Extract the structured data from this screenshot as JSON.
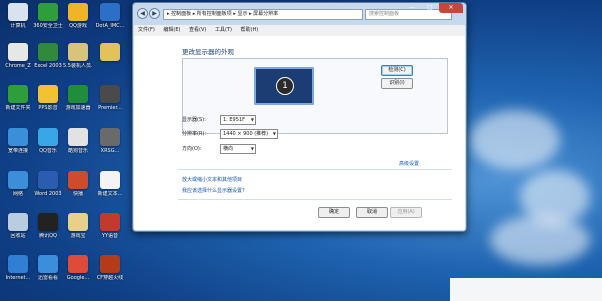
{
  "desktop": {
    "icons": [
      {
        "label": "计算机",
        "color": "#d9e3ef"
      },
      {
        "label": "360安全卫士",
        "color": "#2e9e3a"
      },
      {
        "label": "QQ游戏",
        "color": "#f0b428"
      },
      {
        "label": "DotA_IMC...",
        "color": "#2b6fc6"
      },
      {
        "label": "Chrome_Z",
        "color": "#e7e7e7"
      },
      {
        "label": "Excel 2003",
        "color": "#2f8a3e"
      },
      {
        "label": "5.5装机人员...",
        "color": "#d9c27a"
      },
      {
        "label": "",
        "color": "#e2c25a"
      },
      {
        "label": "新建文件夹",
        "color": "#2e9e3a"
      },
      {
        "label": "PPS影音",
        "color": "#f2c230"
      },
      {
        "label": "游戏加速器",
        "color": "#1f8d3c"
      },
      {
        "label": "Premier...",
        "color": "#4a4a4a"
      },
      {
        "label": "宽带连接",
        "color": "#3a8fd8"
      },
      {
        "label": "QQ音乐",
        "color": "#39a7e5"
      },
      {
        "label": "酷狗音乐",
        "color": "#e2e2e2"
      },
      {
        "label": "XRSG...",
        "color": "#6a6a6a"
      },
      {
        "label": "网络",
        "color": "#3a8fd8"
      },
      {
        "label": "Word 2003",
        "color": "#2a5db0"
      },
      {
        "label": "快播",
        "color": "#d04a2e"
      },
      {
        "label": "新建文本...",
        "color": "#f4f4f4"
      },
      {
        "label": "回收站",
        "color": "#b8cde0"
      },
      {
        "label": "腾讯QQ",
        "color": "#222"
      },
      {
        "label": "游戏宝",
        "color": "#e6d08a"
      },
      {
        "label": "YY语音",
        "color": "#c3392b"
      },
      {
        "label": "Internet...",
        "color": "#2f7fd4"
      },
      {
        "label": "迅雷看看",
        "color": "#3b8edb"
      },
      {
        "label": "Google...",
        "color": "#e04a3a"
      },
      {
        "label": "CF穿越火线",
        "color": "#b23b1a"
      }
    ]
  },
  "window": {
    "nav_back": "◀",
    "nav_forward": "▶",
    "address": "▸ 控制面板 ▸ 所有控制面板项 ▸ 显示 ▸ 屏幕分辨率",
    "search_placeholder": "搜索控制面板",
    "controls": {
      "minimize": "—",
      "maximize": "□",
      "close": "✕"
    },
    "menu": [
      "文件(F)",
      "编辑(E)",
      "查看(V)",
      "工具(T)",
      "帮助(H)"
    ],
    "heading": "更改显示器的外观",
    "monitor_number": "1",
    "detect_button": "检测(C)",
    "identify_button": "识别(I)",
    "display_label": "显示器(S):",
    "display_value": "1. E951F",
    "resolution_label": "分辨率(R):",
    "resolution_value": "1440 × 900 (推荐)",
    "orientation_label": "方向(O):",
    "orientation_value": "横向",
    "advanced_link": "高级设置",
    "link_text_size": "放大或缩小文本和其他项目",
    "link_which_settings": "我应该选择什么显示器设置?",
    "ok_button": "确定",
    "cancel_button": "取消",
    "apply_button": "应用(A)"
  }
}
